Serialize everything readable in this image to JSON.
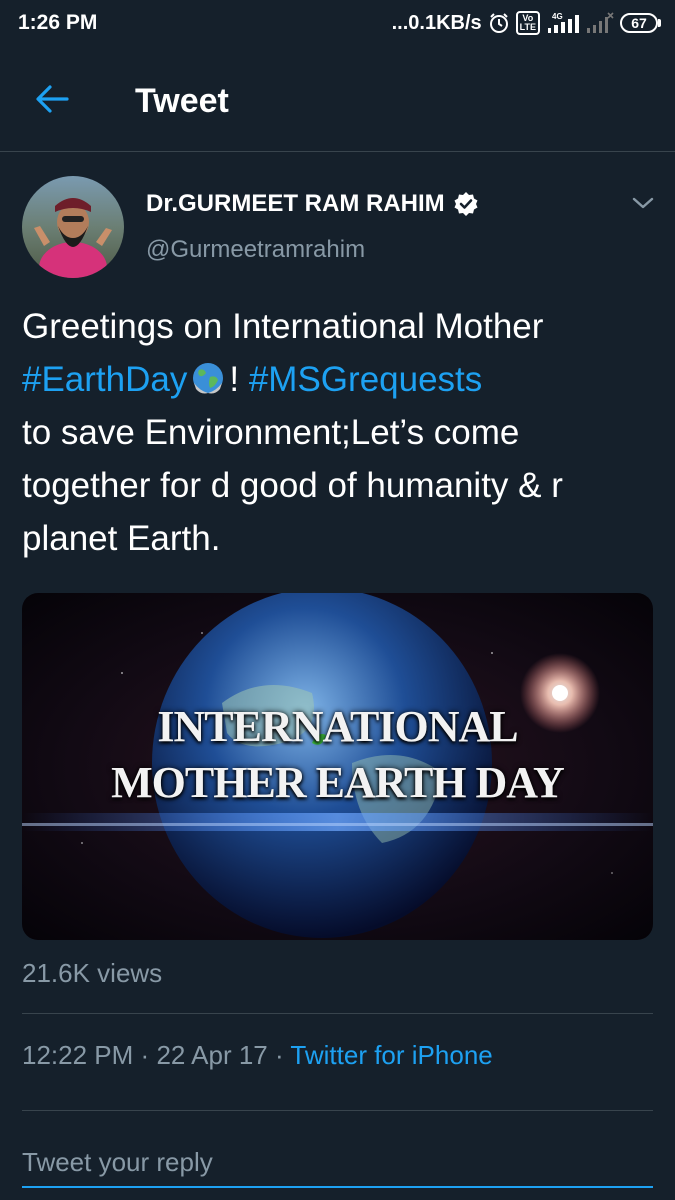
{
  "status_bar": {
    "time": "1:26 PM",
    "net_speed": "...0.1KB/s",
    "volte_label": "Vo\nLTE",
    "network_label": "4G",
    "battery_level": "67",
    "icons": [
      "alarm-icon",
      "volte-icon",
      "signal-icon",
      "signal-no-service-icon",
      "battery-icon"
    ]
  },
  "app_bar": {
    "title": "Tweet",
    "back_icon": "arrow-left-icon"
  },
  "tweet": {
    "author_name": "Dr.GURMEET RAM RAHIM",
    "author_handle": "@Gurmeetramrahim",
    "verified": true,
    "text": {
      "part1": "Greetings on International Mother",
      "hashtag1": "#EarthDay",
      "emoji": "globe-emoji",
      "part2": "!",
      "hashtag2": "#MSGrequests",
      "part3": "to save Environment;Let’s come together for d good of humanity & r planet Earth."
    },
    "media": {
      "line1": "INTERNATIONAL",
      "line2": "MOTHER EARTH DAY"
    },
    "views": "21.6K views",
    "time": "12:22 PM",
    "separator": "·",
    "date": "22 Apr 17",
    "source": "Twitter for iPhone"
  },
  "reply": {
    "placeholder": "Tweet your reply"
  },
  "colors": {
    "background": "#15202b",
    "accent": "#1da1f2",
    "secondary_text": "#8899a6",
    "divider": "#38444d"
  }
}
